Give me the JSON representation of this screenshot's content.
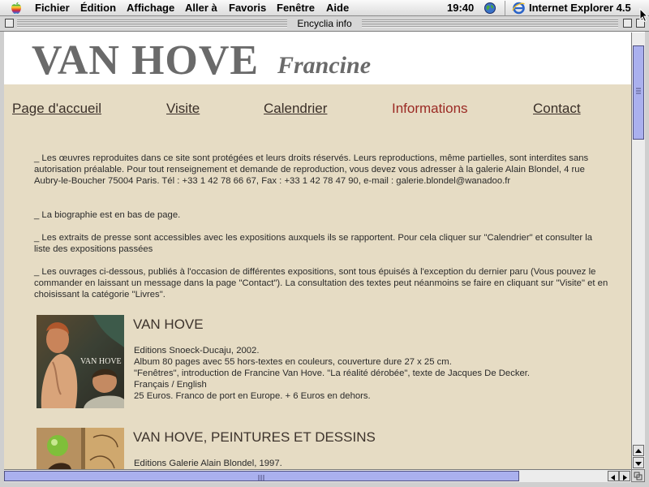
{
  "menubar": {
    "items": [
      "Fichier",
      "Édition",
      "Affichage",
      "Aller à",
      "Favoris",
      "Fenêtre",
      "Aide"
    ],
    "clock": "19:40",
    "app_name": "Internet Explorer 4.5"
  },
  "window": {
    "title": "Encyclia info"
  },
  "page": {
    "artist_last": "VAN HOVE",
    "artist_first": "Francine",
    "nav": [
      "Page d'accueil",
      "Visite",
      "Calendrier",
      "Informations",
      "Contact"
    ],
    "active_nav": "Informations",
    "paragraphs": [
      "_ Les œuvres reproduites dans ce site sont protégées et leurs droits réservés. Leurs reproductions, même partielles, sont interdites sans autorisation préalable. Pour tout renseignement et demande de reproduction, vous devez vous adresser à la galerie Alain Blondel, 4 rue Aubry-le-Boucher 75004 Paris. Tél : +33 1 42 78 66 67, Fax : +33 1 42 78 47 90, e-mail : galerie.blondel@wanadoo.fr",
      "_ La biographie est en bas de page.",
      "_ Les extraits de presse sont accessibles avec les expositions auxquels ils se rapportent. Pour cela cliquer sur \"Calendrier\" et consulter la liste des expositions passées",
      "_ Les ouvrages ci-dessous, publiés à l'occasion de différentes expositions, sont tous épuisés à l'exception du dernier paru (Vous pouvez le commander en laissant un message dans la page \"Contact\"). La consultation des textes peut néanmoins se faire en cliquant sur \"Visite\" et en choisissant la catégorie \"Livres\"."
    ],
    "books": [
      {
        "title": "VAN HOVE",
        "cover_text": "VAN HOVE",
        "lines": [
          "Editions Snoeck-Ducaju, 2002.",
          "Album 80 pages avec 55 hors-textes en couleurs, couverture dure 27 x 25 cm.",
          "\"Fenêtres\", introduction de Francine Van Hove. \"La réalité dérobée\", texte de Jacques De Decker.",
          "Français / English",
          "25 Euros. Franco de port en Europe. + 6 Euros en dehors."
        ]
      },
      {
        "title": "VAN HOVE, PEINTURES ET DESSINS",
        "lines": [
          "Editions Galerie Alain Blondel, 1997."
        ]
      }
    ]
  },
  "colors": {
    "page_bg": "#e6dcc4",
    "nav_active": "#9b2a24",
    "scroll_thumb": "#aab0ee"
  }
}
